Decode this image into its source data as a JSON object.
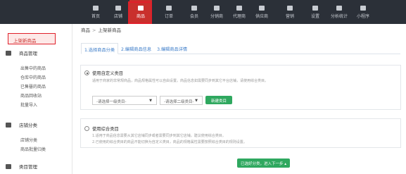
{
  "nav": {
    "items": [
      {
        "label": "首页",
        "icon": "home-icon"
      },
      {
        "label": "店铺",
        "icon": "store-icon"
      },
      {
        "label": "商品",
        "icon": "bag-icon"
      },
      {
        "label": "订单",
        "icon": "order-icon"
      },
      {
        "label": "会员",
        "icon": "member-icon"
      },
      {
        "label": "分销商",
        "icon": "distributor-icon"
      },
      {
        "label": "代理商",
        "icon": "agent-icon"
      },
      {
        "label": "供应商",
        "icon": "supplier-icon"
      },
      {
        "label": "营销",
        "icon": "marketing-icon"
      },
      {
        "label": "设置",
        "icon": "gear-icon"
      },
      {
        "label": "分析统计",
        "icon": "chart-icon"
      },
      {
        "label": "小程序",
        "icon": "miniprogram-icon"
      }
    ],
    "active_color": "#c9302c"
  },
  "sidebar": {
    "active_item": "上架新商品",
    "groups": [
      {
        "label": "商品管理",
        "links": [
          "出售中的商品",
          "仓库中的商品",
          "已售罄的商品",
          "商品回收站",
          "批量导入"
        ]
      },
      {
        "label": "店铺分类",
        "links": [
          "店铺分类",
          "商品批量归类"
        ]
      },
      {
        "label": "类目管理",
        "links": []
      }
    ]
  },
  "breadcrumb": {
    "root": "商品",
    "sep": ">",
    "current": "上架新商品"
  },
  "tabs": [
    "1.选择商品分类",
    "2.编辑商品信息",
    "3.编辑商品详情"
  ],
  "option1": {
    "title": "使用自定义类目",
    "desc": "适用于商家的非常规商品，商品规格属性可以自由设置。商品信息如需要同步到其它平台店铺，请使用综合类目。",
    "select1": "-请选择一级类目-",
    "select2": "-请选择二级类目-",
    "new_button": "新建类目"
  },
  "option2": {
    "title": "使用综合类目",
    "desc1": "1.适用于商品信息需要从其它店铺同步或者需要同步到其它店铺，建议使用综合类目。",
    "desc2": "2.已使用的综合类目的商品不能切换为自定义类目，商品的规格属性需要按照综合类目的规则设置。"
  },
  "next_button": "已选好分类，进入下一步 ▴",
  "colors": {
    "accent_green": "#2fa85f",
    "highlight_red": "#e0202a",
    "link_blue": "#3a7bc8",
    "topbar": "#2b3038"
  }
}
